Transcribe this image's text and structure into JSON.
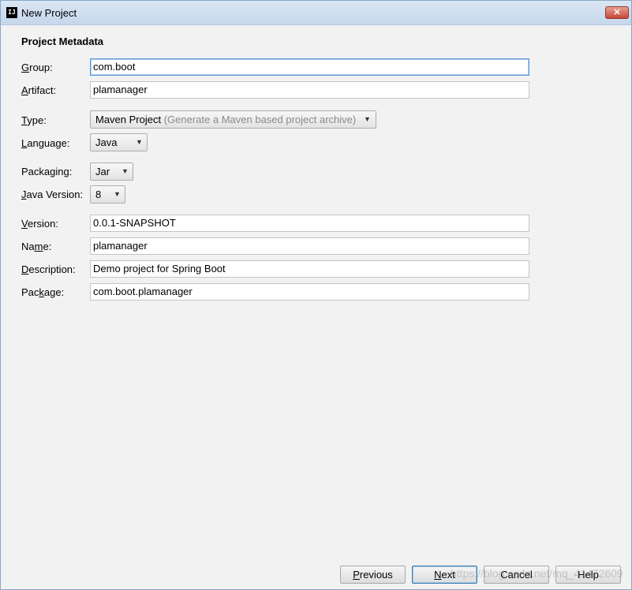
{
  "window": {
    "title": "New Project",
    "app_icon_text": "IJ",
    "close_symbol": "✕"
  },
  "section_title": "Project Metadata",
  "fields": {
    "group": {
      "label_key": "G",
      "label_rest": "roup:",
      "value": "com.boot"
    },
    "artifact": {
      "label_key": "A",
      "label_rest": "rtifact:",
      "value": "plamanager"
    },
    "type": {
      "label_key": "T",
      "label_rest": "ype:",
      "value": "Maven Project",
      "hint": "(Generate a Maven based project archive)"
    },
    "language": {
      "label_key": "L",
      "label_rest": "anguage:",
      "value": "Java"
    },
    "packaging": {
      "label_pre": "Packa",
      "label_key": "g",
      "label_rest": "ing:",
      "value": "Jar"
    },
    "java_version": {
      "label_key": "J",
      "label_rest": "ava Version:",
      "value": "8"
    },
    "version": {
      "label_key": "V",
      "label_rest": "ersion:",
      "value": "0.0.1-SNAPSHOT"
    },
    "name": {
      "label_pre": "Na",
      "label_key": "m",
      "label_rest": "e:",
      "value": "plamanager"
    },
    "description": {
      "label_key": "D",
      "label_rest": "escription:",
      "value": "Demo project for Spring Boot"
    },
    "package": {
      "label_pre": "Pac",
      "label_key": "k",
      "label_rest": "age:",
      "value": "com.boot.plamanager"
    }
  },
  "buttons": {
    "previous": {
      "key": "P",
      "rest": "revious"
    },
    "next": {
      "key": "N",
      "rest": "ext"
    },
    "cancel": {
      "label": "Cancel"
    },
    "help": {
      "label": "Help"
    }
  },
  "watermark": "https://blog.csdn.net/mq_41472609",
  "icons": {
    "dropdown": "chevron-down-icon",
    "close": "close-icon"
  }
}
